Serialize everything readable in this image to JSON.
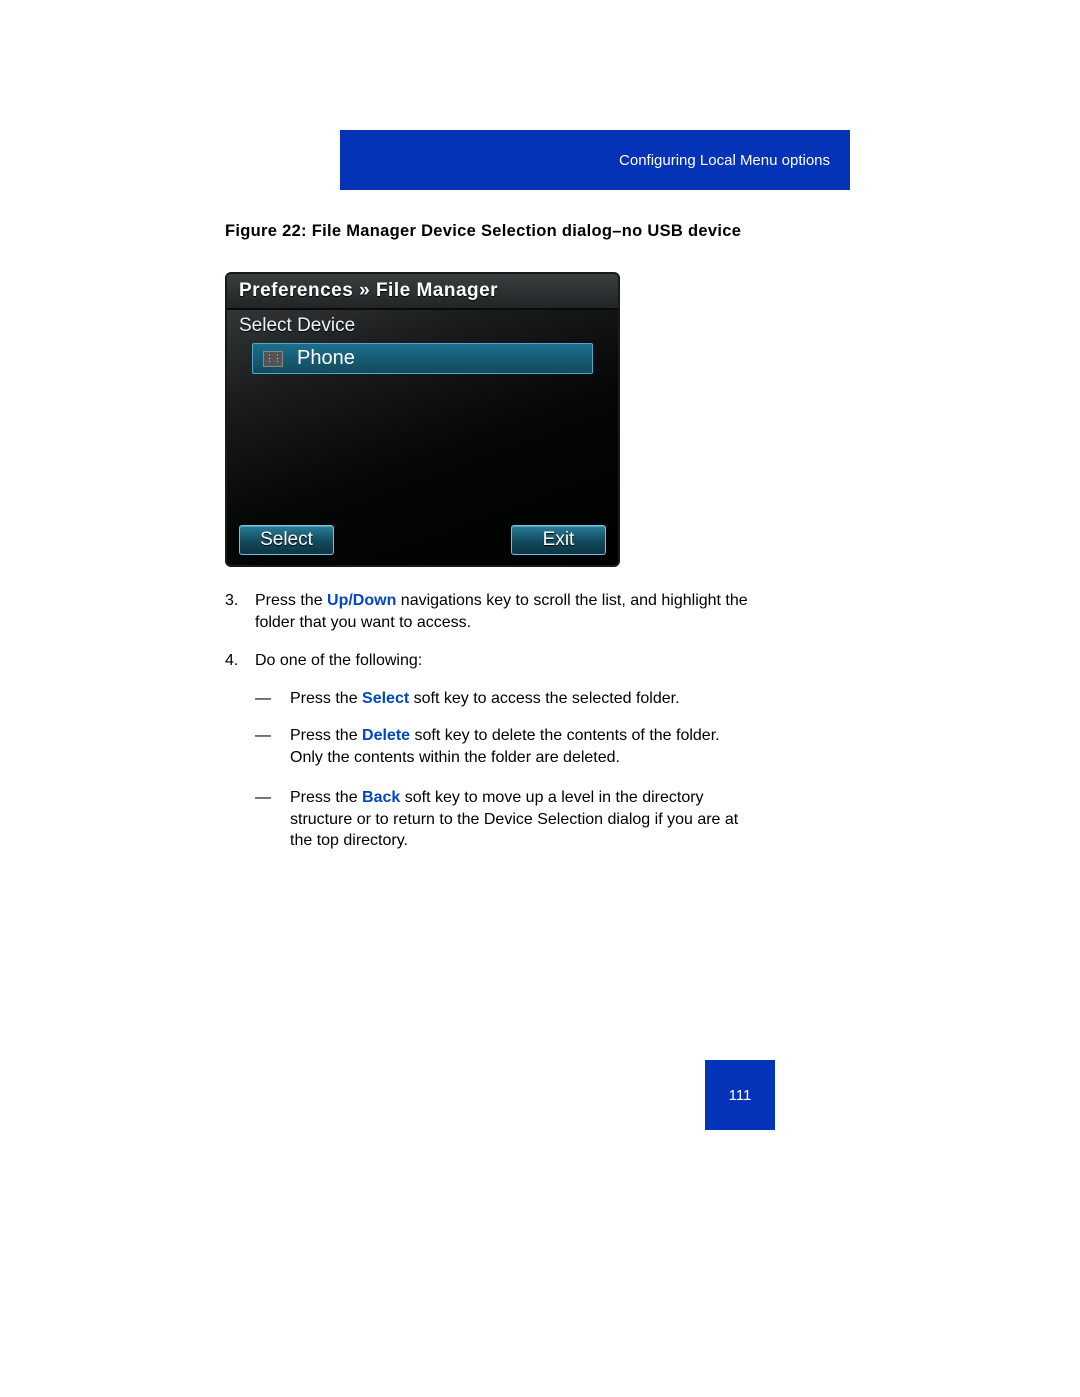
{
  "header": {
    "section_title": "Configuring Local Menu options"
  },
  "figure": {
    "caption": "Figure 22: File Manager Device Selection dialog–no USB device"
  },
  "screen": {
    "breadcrumb_root": "Preferences",
    "breadcrumb_chev": "»",
    "breadcrumb_leaf": "File Manager",
    "subheader": "Select Device",
    "device_label": "Phone",
    "softkey_left": "Select",
    "softkey_right": "Exit"
  },
  "steps": {
    "s3_num": "3.",
    "s3_pre": "Press the ",
    "s3_emph": "Up/Down",
    "s3_post": " navigations key to scroll the list, and highlight the folder that you want to access.",
    "s4_num": "4.",
    "s4_text": "Do one of the following:"
  },
  "bullets": {
    "dash": "—",
    "b1_pre": "Press the ",
    "b1_emph": "Select",
    "b1_post": " soft key to access the selected folder.",
    "b2_pre": "Press the ",
    "b2_emph": "Delete",
    "b2_post": " soft key to delete the contents of the folder. Only the contents within the folder are deleted.",
    "b3_pre": "Press the ",
    "b3_emph": "Back",
    "b3_post": " soft key to move up a level in the directory structure or to return to the Device Selection dialog if you are at the top directory."
  },
  "page_number": "111"
}
